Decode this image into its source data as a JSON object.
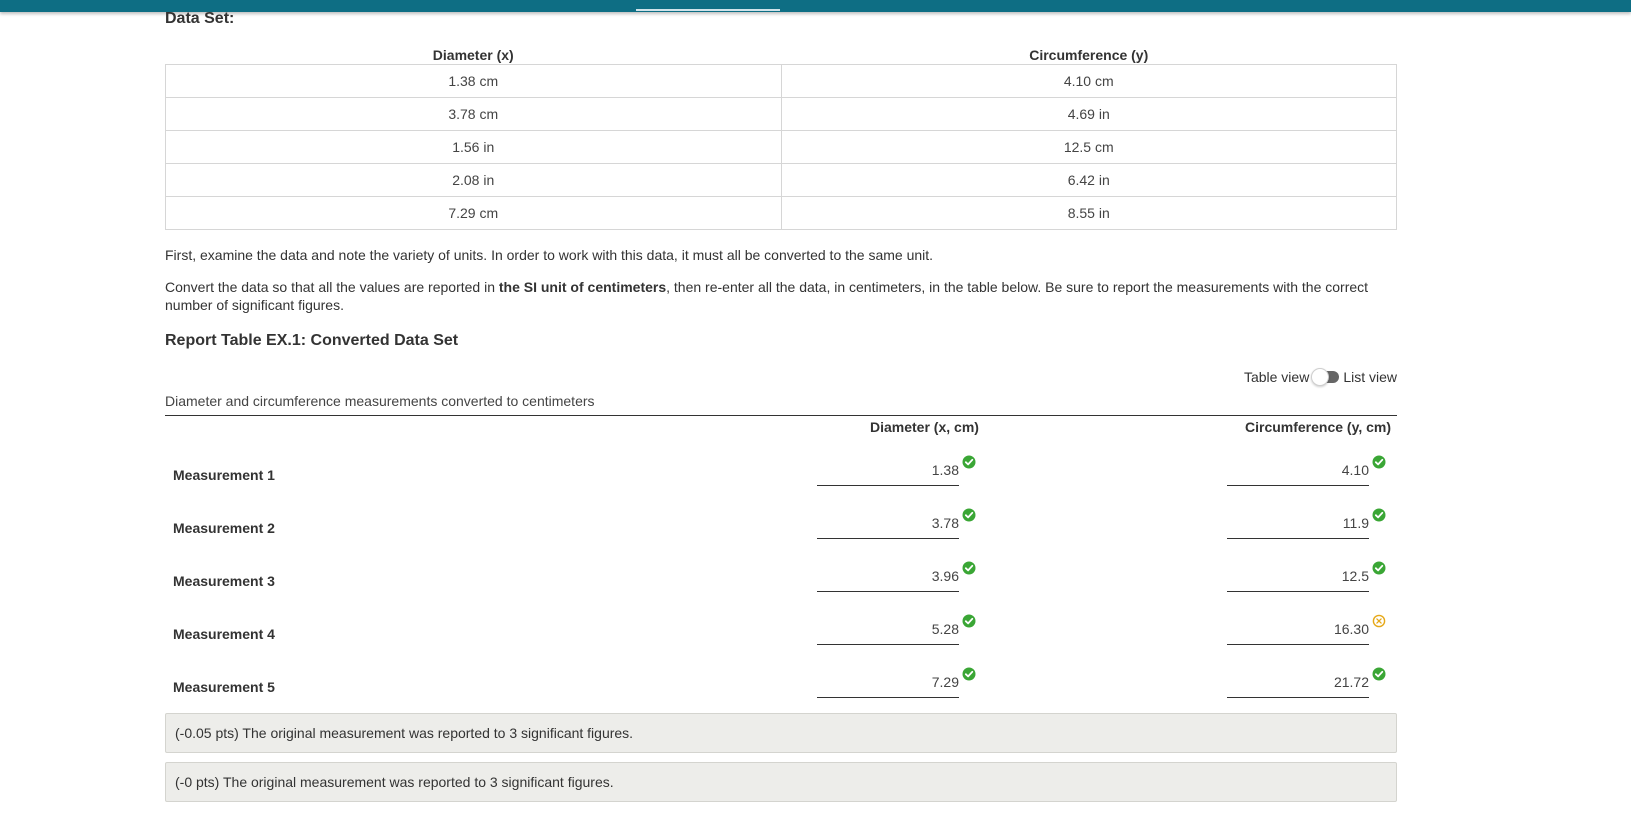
{
  "dataset": {
    "heading": "Data Set:",
    "headers": [
      "Diameter (x)",
      "Circumference (y)"
    ],
    "rows": [
      [
        "1.38 cm",
        "4.10 cm"
      ],
      [
        "3.78 cm",
        "4.69 in"
      ],
      [
        "1.56 in",
        "12.5 cm"
      ],
      [
        "2.08 in",
        "6.42 in"
      ],
      [
        "7.29 cm",
        "8.55 in"
      ]
    ]
  },
  "instructions": {
    "para1": "First, examine the data and note the variety of units. In order to work with this data, it must all be converted to the same unit.",
    "para2_pre": "Convert the data so that all the values are reported in ",
    "para2_bold": "the SI unit of centimeters",
    "para2_post": ", then re-enter all the data, in centimeters, in the table below. Be sure to report the measurements with the correct number of significant figures."
  },
  "report": {
    "title": "Report Table EX.1: Converted Data Set",
    "toggle_left": "Table view",
    "toggle_right": "List view",
    "caption": "Diameter and circumference measurements converted to centimeters",
    "col_diameter": "Diameter (x, cm)",
    "col_circumference": "Circumference (y, cm)",
    "rows": [
      {
        "label": "Measurement 1",
        "diameter": "1.38",
        "diameter_status": "correct",
        "circumference": "4.10",
        "circumference_status": "correct"
      },
      {
        "label": "Measurement 2",
        "diameter": "3.78",
        "diameter_status": "correct",
        "circumference": "11.9",
        "circumference_status": "correct"
      },
      {
        "label": "Measurement 3",
        "diameter": "3.96",
        "diameter_status": "correct",
        "circumference": "12.5",
        "circumference_status": "correct"
      },
      {
        "label": "Measurement 4",
        "diameter": "5.28",
        "diameter_status": "correct",
        "circumference": "16.30",
        "circumference_status": "warning"
      },
      {
        "label": "Measurement 5",
        "diameter": "7.29",
        "diameter_status": "correct",
        "circumference": "21.72",
        "circumference_status": "correct"
      }
    ],
    "feedback": [
      "(-0.05 pts) The original measurement was reported to 3 significant figures.",
      "(-0 pts) The original measurement was reported to 3 significant figures."
    ]
  },
  "colors": {
    "header_bar": "#0e6e84",
    "correct": "#3aa635",
    "warning": "#e6a817"
  }
}
